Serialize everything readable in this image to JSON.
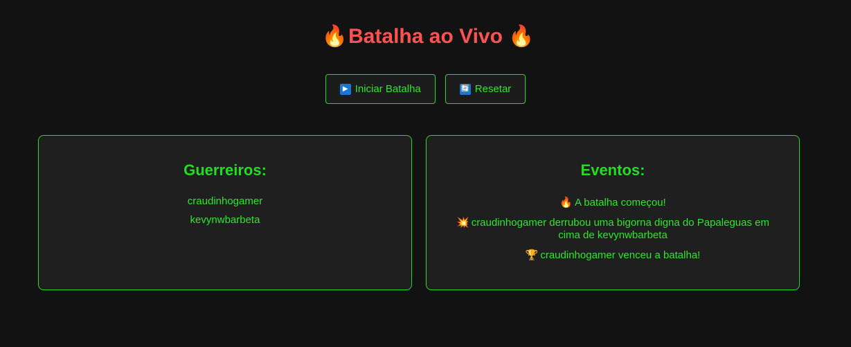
{
  "header": {
    "title": "Batalha ao Vivo",
    "left_emoji": "🔥",
    "right_emoji": "🔥"
  },
  "controls": {
    "start_icon": "▶",
    "start_label": "Iniciar Batalha",
    "reset_icon": "🔄",
    "reset_label": "Resetar"
  },
  "warriors_panel": {
    "heading": "Guerreiros:",
    "items": [
      "craudinhogamer",
      "kevynwbarbeta"
    ]
  },
  "events_panel": {
    "heading": "Eventos:",
    "items": [
      {
        "emoji": "🔥",
        "text": "A batalha começou!"
      },
      {
        "emoji": "💥",
        "text": "craudinhogamer derrubou uma bigorna digna do Papaleguas em cima de kevynwbarbeta"
      },
      {
        "emoji": "🏆",
        "text": "craudinhogamer venceu a batalha!"
      }
    ]
  },
  "colors": {
    "background": "#121212",
    "title": "#ff5252",
    "accent": "#22dd22",
    "panel": "#1f1f1f"
  }
}
